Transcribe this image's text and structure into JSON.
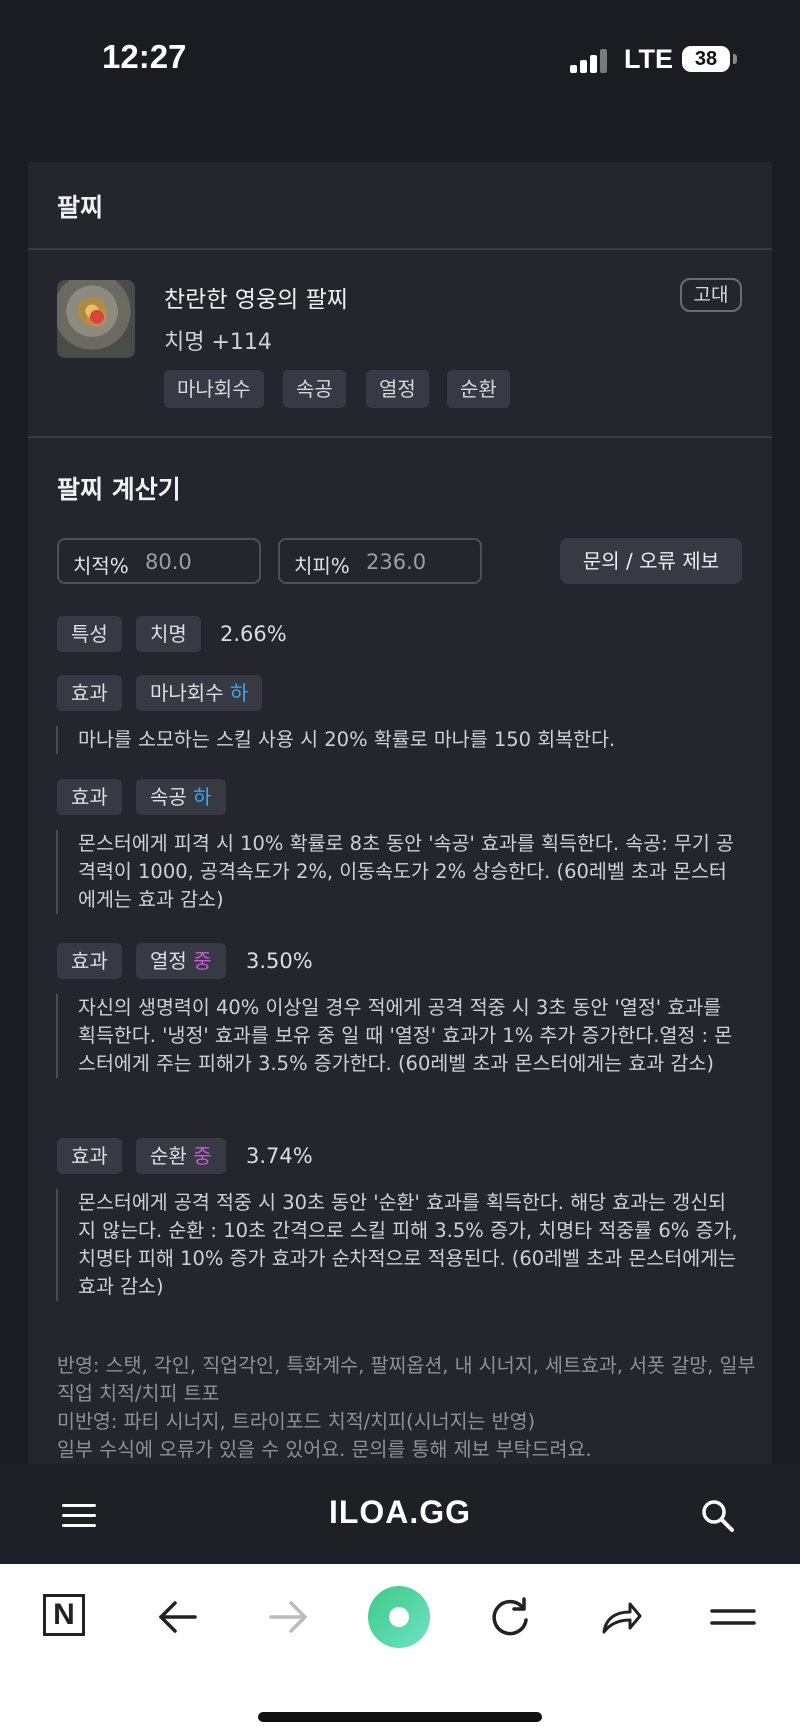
{
  "status_bar": {
    "time": "12:27",
    "network": "LTE",
    "battery": "38"
  },
  "panel": {
    "title": "팔찌",
    "item": {
      "name": "찬란한 영웅의 팔찌",
      "stat": "치명 +114",
      "grade": "고대",
      "tags": [
        "마나회수",
        "속공",
        "열정",
        "순환"
      ]
    },
    "calculator": {
      "title": "팔찌 계산기",
      "crit_rate": {
        "label": "치적%",
        "value": "80.0"
      },
      "crit_damage": {
        "label": "치피%",
        "value": "236.0"
      },
      "report_button": "문의 / 오류 제보",
      "trait": {
        "label": "특성",
        "stat": "치명",
        "value": "2.66%"
      },
      "effects": [
        {
          "label": "효과",
          "name": "마나회수",
          "level": "하",
          "level_type": "low",
          "value": "",
          "description": "마나를 소모하는 스킬 사용 시 20% 확률로 마나를 150 회복한다."
        },
        {
          "label": "효과",
          "name": "속공",
          "level": "하",
          "level_type": "low",
          "value": "",
          "description": "몬스터에게 피격 시 10% 확률로 8초 동안 '속공' 효과를 획득한다. 속공: 무기 공격력이 1000, 공격속도가 2%, 이동속도가 2% 상승한다. (60레벨 초과 몬스터에게는 효과 감소)"
        },
        {
          "label": "효과",
          "name": "열정",
          "level": "중",
          "level_type": "mid",
          "value": "3.50%",
          "description": "자신의 생명력이 40% 이상일 경우 적에게 공격 적중 시 3초 동안 '열정' 효과를 획득한다. '냉정' 효과를 보유 중 일 때 '열정' 효과가 1% 추가 증가한다.열정 : 몬스터에게 주는 피해가 3.5% 증가한다. (60레벨 초과 몬스터에게는 효과 감소)"
        },
        {
          "label": "효과",
          "name": "순환",
          "level": "중",
          "level_type": "mid",
          "value": "3.74%",
          "description": "몬스터에게 공격 적중 시 30초 동안 '순환' 효과를 획득한다. 해당 효과는 갱신되지 않는다. 순환 : 10초 간격으로 스킬 피해 3.5% 증가, 치명타 적중률 6% 증가, 치명타 피해 10% 증가 효과가 순차적으로 적용된다. (60레벨 초과 몬스터에게는 효과 감소)"
        }
      ],
      "notes": {
        "applied": "반영: 스탯, 각인, 직업각인, 특화계수, 팔찌옵션, 내 시너지, 세트효과, 서폿 갈망, 일부 직업 치적/치피 트포",
        "not_applied": "미반영: 파티 시너지, 트라이포드 치적/치피(시너지는 반영)",
        "error_note": "일부 수식에 오류가 있을 수 있어요. 문의를 통해 제보 부탁드려요."
      }
    }
  },
  "site_nav": {
    "logo": "ILOA.GG"
  },
  "browser": {
    "n_label": "N"
  },
  "colors": {
    "background": "#1b1c21",
    "panel": "#24252d",
    "low": "#3ea6f0",
    "mid": "#c85ad8",
    "home": "#3ec98a"
  }
}
